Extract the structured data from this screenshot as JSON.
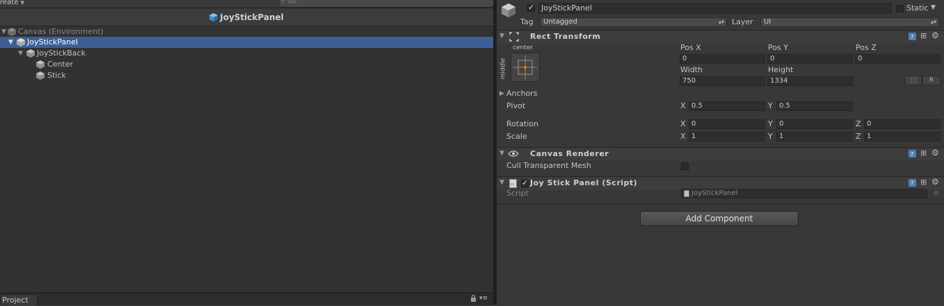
{
  "hierarchy": {
    "create_label": "reate",
    "search_placeholder": "All",
    "scene_title": "JoyStickPanel",
    "items": [
      {
        "label": "Canvas (Environment)"
      },
      {
        "label": "JoyStickPanel"
      },
      {
        "label": "JoyStickBack"
      },
      {
        "label": "Center"
      },
      {
        "label": "Stick"
      }
    ],
    "bottom_tab": "Project"
  },
  "inspector": {
    "object_name": "JoyStickPanel",
    "static_label": "Static",
    "tag_label": "Tag",
    "tag_value": "Untagged",
    "layer_label": "Layer",
    "layer_value": "UI",
    "rect_transform": {
      "title": "Rect Transform",
      "anchor_h": "center",
      "anchor_v": "middle",
      "pos_x_label": "Pos X",
      "pos_x": "0",
      "pos_y_label": "Pos Y",
      "pos_y": "0",
      "pos_z_label": "Pos Z",
      "pos_z": "0",
      "width_label": "Width",
      "width": "750",
      "height_label": "Height",
      "height": "1334",
      "r_button": "R",
      "anchors_label": "Anchors",
      "pivot_label": "Pivot",
      "pivot_x": "0.5",
      "pivot_y": "0.5",
      "rotation_label": "Rotation",
      "rot_x": "0",
      "rot_y": "0",
      "rot_z": "0",
      "scale_label": "Scale",
      "scale_x": "1",
      "scale_y": "1",
      "scale_z": "1",
      "x": "X",
      "y": "Y",
      "z": "Z"
    },
    "canvas_renderer": {
      "title": "Canvas Renderer",
      "cull_label": "Cull Transparent Mesh"
    },
    "script_comp": {
      "title": "Joy Stick Panel (Script)",
      "script_label": "Script",
      "script_value": "JoyStickPanel"
    },
    "add_component": "Add Component"
  },
  "colors": {
    "selection": "#3e5f96",
    "panel": "#383838",
    "field": "#2e2e2e",
    "accent_orange": "#e07a1f"
  }
}
